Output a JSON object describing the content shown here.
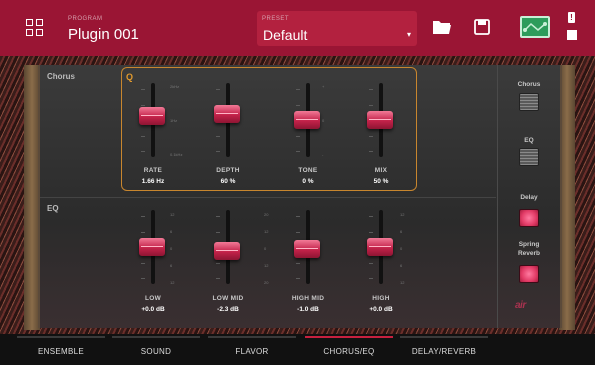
{
  "header": {
    "program_label": "PROGRAM",
    "plugin_name": "Plugin 001",
    "preset_label": "PRESET",
    "preset_value": "Default",
    "warning": "!"
  },
  "colors": {
    "header": "#9a1534",
    "accent": "#c8203f",
    "chorus_frame": "#c8862e"
  },
  "chorus": {
    "title": "Chorus",
    "q_label": "Q",
    "rate_scale": [
      "2kHz",
      "1Hz",
      "0.1kHz"
    ],
    "tone_scale": [
      "+",
      "0",
      "-"
    ],
    "faders": [
      {
        "label": "RATE",
        "value": "1.66 Hz",
        "level": 0.58
      },
      {
        "label": "DEPTH",
        "value": "60 %",
        "level": 0.6
      },
      {
        "label": "TONE",
        "value": "0 %",
        "level": 0.5
      },
      {
        "label": "MIX",
        "value": "50 %",
        "level": 0.5
      }
    ]
  },
  "eq": {
    "title": "EQ",
    "scale": [
      "12",
      "6",
      "0",
      "6",
      "12"
    ],
    "mid_scale": [
      "20",
      "12",
      "0",
      "12",
      "20"
    ],
    "faders": [
      {
        "label": "LOW",
        "value": "+0.0 dB",
        "level": 0.5
      },
      {
        "label": "LOW MID",
        "value": "-2.3 dB",
        "level": 0.42
      },
      {
        "label": "HIGH MID",
        "value": "-1.0 dB",
        "level": 0.46
      },
      {
        "label": "HIGH",
        "value": "+0.0 dB",
        "level": 0.5
      }
    ]
  },
  "effects": [
    {
      "label": "Chorus",
      "on": false
    },
    {
      "label": "EQ",
      "on": false
    },
    {
      "label": "Delay",
      "on": true
    },
    {
      "label": "Spring Reverb",
      "on": true
    }
  ],
  "logo": "air",
  "tabs": [
    {
      "label": "ENSEMBLE",
      "active": false
    },
    {
      "label": "SOUND",
      "active": false
    },
    {
      "label": "FLAVOR",
      "active": false
    },
    {
      "label": "CHORUS/EQ",
      "active": true
    },
    {
      "label": "DELAY/REVERB",
      "active": false
    }
  ],
  "icons": {
    "grid": "grid-icon",
    "folder": "folder-icon",
    "save": "save-icon",
    "routing": "routing-icon",
    "warning": "warning-icon",
    "chip": "chip-icon"
  }
}
